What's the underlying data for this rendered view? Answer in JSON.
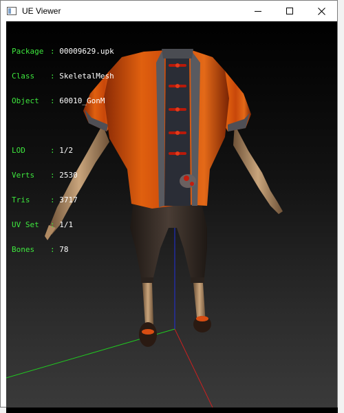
{
  "window": {
    "title": "UE Viewer"
  },
  "icons": {
    "app": "app-window-icon",
    "minimize": "minimize-icon",
    "maximize": "maximize-icon",
    "close": "close-icon"
  },
  "info": {
    "package_label": "Package",
    "package_value": "00009629.upk",
    "class_label": "Class",
    "class_value": "SkeletalMesh",
    "object_label": "Object",
    "object_value": "60010_GonM",
    "lod_label": "LOD",
    "lod_value": "1/2",
    "verts_label": "Verts",
    "verts_value": "2530",
    "tris_label": "Tris",
    "tris_value": "3717",
    "uvset_label": "UV Set",
    "uvset_value": "1/1",
    "bones_label": "Bones",
    "bones_value": "78"
  },
  "colors": {
    "info_label": "#3ee83e",
    "info_value": "#ffffff",
    "axis_x": "#cc2020",
    "axis_y": "#20cc20",
    "axis_z": "#2030dd",
    "shirt": "#d8510d",
    "pants": "#3a302b"
  }
}
